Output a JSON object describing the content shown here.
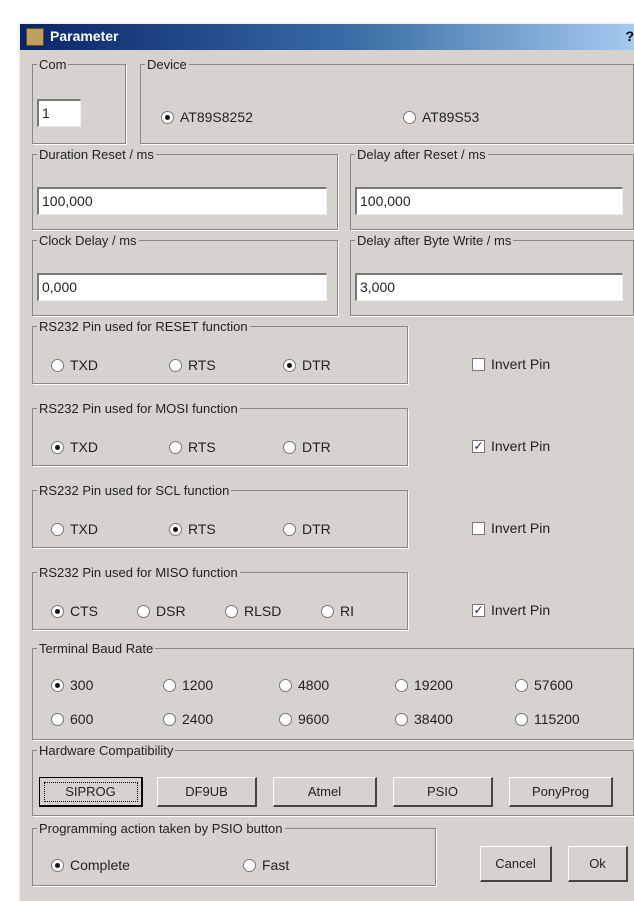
{
  "window": {
    "title": "Parameter",
    "help": "?"
  },
  "com": {
    "legend": "Com",
    "value": "1"
  },
  "device": {
    "legend": "Device",
    "options": [
      "AT89S8252",
      "AT89S53"
    ]
  },
  "duration_reset": {
    "legend": "Duration Reset / ms",
    "value": "100,000"
  },
  "delay_after_reset": {
    "legend": "Delay after Reset / ms",
    "value": "100,000"
  },
  "clock_delay": {
    "legend": "Clock Delay / ms",
    "value": "0,000"
  },
  "delay_after_byte": {
    "legend": "Delay after Byte Write / ms",
    "value": "3,000"
  },
  "reset_pin": {
    "legend": "RS232 Pin used for RESET function",
    "options": [
      "TXD",
      "RTS",
      "DTR"
    ],
    "invert": "Invert Pin"
  },
  "mosi_pin": {
    "legend": "RS232 Pin used for MOSI function",
    "options": [
      "TXD",
      "RTS",
      "DTR"
    ],
    "invert": "Invert Pin"
  },
  "sck_pin": {
    "legend": "RS232 Pin used for SCL function",
    "options": [
      "TXD",
      "RTS",
      "DTR"
    ],
    "invert": "Invert Pin"
  },
  "miso_pin": {
    "legend": "RS232 Pin used for MISO function",
    "options": [
      "CTS",
      "DSR",
      "RLSD",
      "RI"
    ],
    "invert": "Invert Pin"
  },
  "baud": {
    "legend": "Terminal Baud Rate",
    "row1": [
      "300",
      "1200",
      "4800",
      "19200",
      "57600"
    ],
    "row2": [
      "600",
      "2400",
      "9600",
      "38400",
      "115200"
    ]
  },
  "hardware": {
    "legend": "Hardware Compatibility",
    "buttons": [
      "SIPROG",
      "DF9UB",
      "Atmel",
      "PSIO",
      "PonyProg"
    ]
  },
  "prog_action": {
    "legend": "Programming action taken by PSIO button",
    "options": [
      "Complete",
      "Fast"
    ]
  },
  "cancel_label": "Cancel",
  "ok_label": "Ok"
}
